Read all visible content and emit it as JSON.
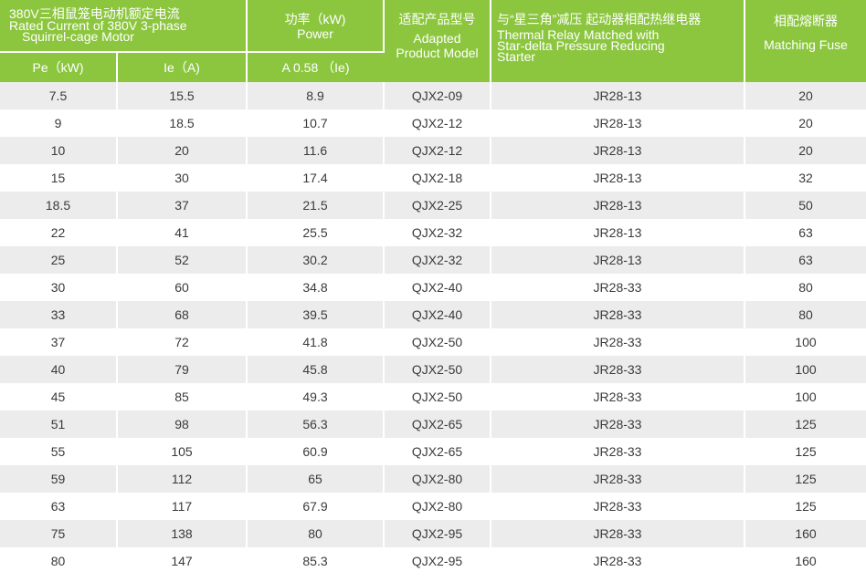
{
  "header": {
    "motor_cn": "380V三相鼠笼电动机额定电流",
    "motor_en_1": "Rated Current of 380V 3-phase",
    "motor_en_2": "Squirrel-cage Motor",
    "power_cn": "功率（kW)",
    "power_en": "Power",
    "model_cn": "适配产品型号",
    "model_en_1": "Adapted",
    "model_en_2": "Product Model",
    "relay_cn": "与“星三角”减压 起动器相配热继电器",
    "relay_en_1": "Thermal Relay Matched with",
    "relay_en_2": "Star-delta Pressure Reducing",
    "relay_en_3": "Starter",
    "fuse_cn": "相配熔断器",
    "fuse_en": "Matching Fuse",
    "sub_pe": "Pe（kW)",
    "sub_ie": "Ie（A)",
    "sub_power": "A 0.58 （Ie)"
  },
  "colors": {
    "header_green": "#8cc63f",
    "row_stripe": "#ececec",
    "text": "#3a3a3a"
  },
  "rows": [
    [
      "7.5",
      "15.5",
      "8.9",
      "QJX2-09",
      "JR28-13",
      "20"
    ],
    [
      "9",
      "18.5",
      "10.7",
      "QJX2-12",
      "JR28-13",
      "20"
    ],
    [
      "10",
      "20",
      "11.6",
      "QJX2-12",
      "JR28-13",
      "20"
    ],
    [
      "15",
      "30",
      "17.4",
      "QJX2-18",
      "JR28-13",
      "32"
    ],
    [
      "18.5",
      "37",
      "21.5",
      "QJX2-25",
      "JR28-13",
      "50"
    ],
    [
      "22",
      "41",
      "25.5",
      "QJX2-32",
      "JR28-13",
      "63"
    ],
    [
      "25",
      "52",
      "30.2",
      "QJX2-32",
      "JR28-13",
      "63"
    ],
    [
      "30",
      "60",
      "34.8",
      "QJX2-40",
      "JR28-33",
      "80"
    ],
    [
      "33",
      "68",
      "39.5",
      "QJX2-40",
      "JR28-33",
      "80"
    ],
    [
      "37",
      "72",
      "41.8",
      "QJX2-50",
      "JR28-33",
      "100"
    ],
    [
      "40",
      "79",
      "45.8",
      "QJX2-50",
      "JR28-33",
      "100"
    ],
    [
      "45",
      "85",
      "49.3",
      "QJX2-50",
      "JR28-33",
      "100"
    ],
    [
      "51",
      "98",
      "56.3",
      "QJX2-65",
      "JR28-33",
      "125"
    ],
    [
      "55",
      "105",
      "60.9",
      "QJX2-65",
      "JR28-33",
      "125"
    ],
    [
      "59",
      "112",
      "65",
      "QJX2-80",
      "JR28-33",
      "125"
    ],
    [
      "63",
      "117",
      "67.9",
      "QJX2-80",
      "JR28-33",
      "125"
    ],
    [
      "75",
      "138",
      "80",
      "QJX2-95",
      "JR28-33",
      "160"
    ],
    [
      "80",
      "147",
      "85.3",
      "QJX2-95",
      "JR28-33",
      "160"
    ]
  ]
}
